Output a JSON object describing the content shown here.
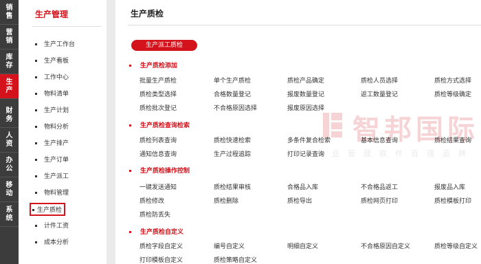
{
  "rail": {
    "items": [
      {
        "label": "销售"
      },
      {
        "label": "营销"
      },
      {
        "label": "库存"
      },
      {
        "label": "生产"
      },
      {
        "label": "财务"
      },
      {
        "label": "人资"
      },
      {
        "label": "办公"
      },
      {
        "label": "移动"
      },
      {
        "label": "系统"
      }
    ],
    "active_color": "#d3121b"
  },
  "sidebar": {
    "title": "生产管理",
    "items": [
      {
        "label": "生产工作台"
      },
      {
        "label": "生产看板"
      },
      {
        "label": "工作中心"
      },
      {
        "label": "物料清单"
      },
      {
        "label": "生产计划"
      },
      {
        "label": "物料分析"
      },
      {
        "label": "生产排产"
      },
      {
        "label": "生产订单"
      },
      {
        "label": "生产派工"
      },
      {
        "label": "物料管理"
      },
      {
        "label": "生产质检"
      },
      {
        "label": "计件工资"
      },
      {
        "label": "成本分析"
      }
    ],
    "active_item": "生产质检"
  },
  "main": {
    "title": "生产质检",
    "dispatch_button": "生产派工质检",
    "sections": [
      {
        "title": "生产质检添加",
        "items": [
          "批量生产质检",
          "单个生产质检",
          "质检产品确定",
          "质检人员选择",
          "质检方式选择",
          "质检类型选择",
          "合格数量登记",
          "报废数量登记",
          "返工数量登记",
          "质检等级确定",
          "质检批次登记",
          "不合格原因选择",
          "报废原因选择"
        ]
      },
      {
        "title": "生产质检查询检索",
        "items": [
          "质检列表查询",
          "质检快速检索",
          "多条件复合检索",
          "基本信息查询",
          "质检结果查询",
          "通知信息查询",
          "生产过程追踪",
          "打印记录查询"
        ]
      },
      {
        "title": "生产质检操作控制",
        "items": [
          "一键发送通知",
          "质检结果审核",
          "合格品入库",
          "不合格品返工",
          "报废品入库",
          "质检修改",
          "质检删除",
          "质检导出",
          "质检网页打印",
          "质检模板打印",
          "质检防丢失"
        ]
      },
      {
        "title": "生产质检自定义",
        "items": [
          "质检字段自定义",
          "编号自定义",
          "明细自定义",
          "不合格原因自定义",
          "质检等级自定义",
          "打印模板自定义",
          "质检策略自定义"
        ]
      }
    ]
  },
  "watermark": {
    "text": "智邦国际",
    "sub": "企业管理软件百强品牌"
  }
}
